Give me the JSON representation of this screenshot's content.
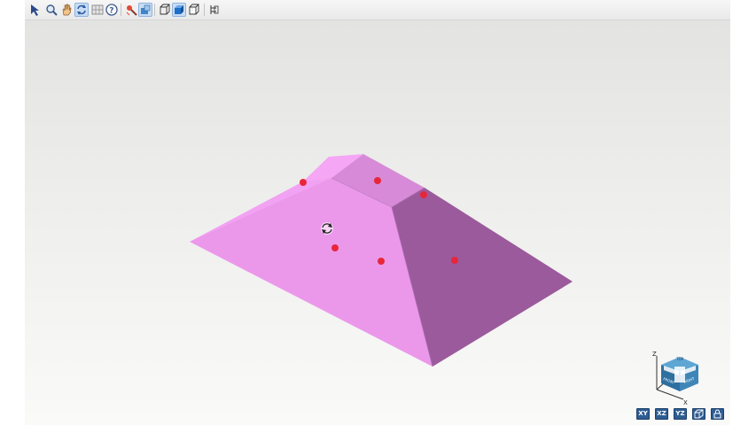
{
  "toolbar": {
    "tools": [
      {
        "name": "select-tool",
        "icon": "arrow-pointer-icon",
        "active": false
      },
      {
        "name": "zoom-tool",
        "icon": "magnifier-icon",
        "active": false
      },
      {
        "name": "pan-tool",
        "icon": "hand-icon",
        "active": false
      },
      {
        "name": "rotate-tool",
        "icon": "rotate-icon",
        "active": true
      },
      {
        "name": "fit-tool",
        "icon": "grid-fit-icon",
        "active": false
      },
      {
        "name": "help-tool",
        "icon": "help-icon",
        "active": false
      },
      {
        "name": "measure-tool",
        "icon": "probe-icon",
        "active": false
      },
      {
        "name": "section-tool",
        "icon": "section-box-icon",
        "active": true
      },
      {
        "name": "wireframe-mode",
        "icon": "wireframe-cube-icon",
        "active": false
      },
      {
        "name": "shaded-mode",
        "icon": "shaded-cube-icon",
        "active": true
      },
      {
        "name": "hidden-line-mode",
        "icon": "hidden-line-cube-icon",
        "active": false
      },
      {
        "name": "export-tool",
        "icon": "export-icon",
        "active": false
      }
    ]
  },
  "colors": {
    "face_left": "#eb98eb",
    "face_right": "#9b5a9b",
    "face_top": "#d78ad7",
    "face_back": "#f2a2f2",
    "vertex_dot": "#e8263a",
    "view_button": "#2e5d93",
    "cube_blue": "#3f86b8"
  },
  "orientation_cube": {
    "axes": [
      "Z",
      "Y",
      "X"
    ],
    "face_labels": [
      "TOP",
      "FRONT",
      "RIGHT"
    ]
  },
  "view_buttons": [
    {
      "name": "view-xy-button",
      "label": "XY"
    },
    {
      "name": "view-xz-button",
      "label": "XZ"
    },
    {
      "name": "view-yz-button",
      "label": "YZ"
    },
    {
      "name": "view-iso-button",
      "label": ""
    },
    {
      "name": "view-lock-button",
      "label": ""
    }
  ]
}
